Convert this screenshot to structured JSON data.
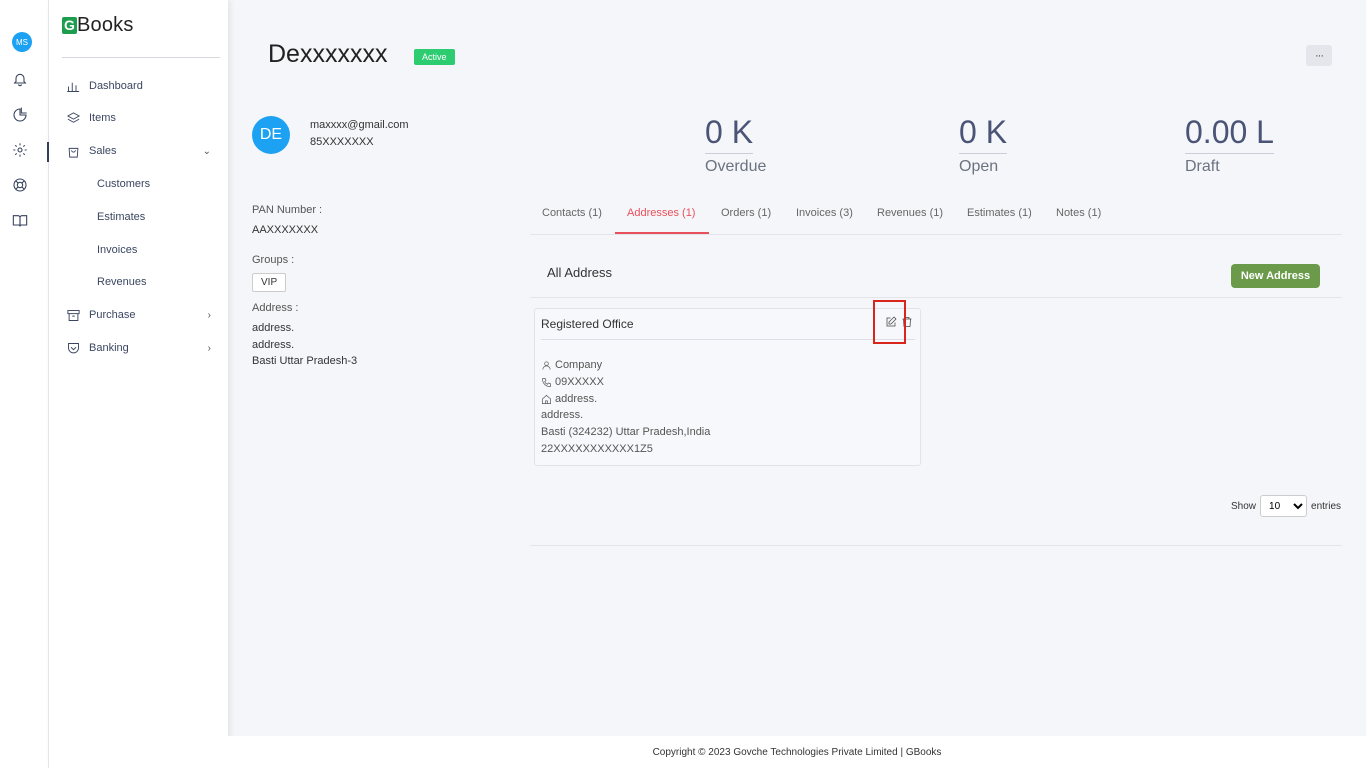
{
  "user": {
    "initials": "MS"
  },
  "brand": {
    "logo_letter": "G",
    "name": "Books"
  },
  "nav": {
    "dashboard": "Dashboard",
    "items": "Items",
    "sales": "Sales",
    "customers": "Customers",
    "estimates": "Estimates",
    "invoices": "Invoices",
    "revenues": "Revenues",
    "purchase": "Purchase",
    "banking": "Banking"
  },
  "customer": {
    "name": "Dexxxxxxx",
    "status": "Active",
    "initials": "DE",
    "email": "maxxxx@gmail.com",
    "phone": "85XXXXXXX",
    "pan_label": "PAN Number :",
    "pan_value": "AAXXXXXXX",
    "groups_label": "Groups :",
    "group": "VIP",
    "address_label": "Address :",
    "address_lines": [
      "address.",
      "address.",
      "Basti Uttar Pradesh-3"
    ]
  },
  "stats": [
    {
      "value": "0 K",
      "label": "Overdue"
    },
    {
      "value": "0 K",
      "label": "Open"
    },
    {
      "value": "0.00 L",
      "label": "Draft"
    }
  ],
  "more_label": "···",
  "tabs": [
    "Contacts (1)",
    "Addresses (1)",
    "Orders (1)",
    "Invoices (3)",
    "Revenues (1)",
    "Estimates (1)",
    "Notes (1)"
  ],
  "addresses": {
    "title": "All Address",
    "new_button": "New Address",
    "card": {
      "title": "Registered Office",
      "type": "Company",
      "phone": "09XXXXX",
      "line1": "address.",
      "line2": "address.",
      "city_line": "Basti (324232) Uttar Pradesh,India",
      "gst": "22XXXXXXXXXXX1Z5"
    }
  },
  "pagination": {
    "show": "Show",
    "value": "10",
    "entries": "entries"
  },
  "footer": "Copyright © 2023 Govche Technologies Private Limited | GBooks"
}
